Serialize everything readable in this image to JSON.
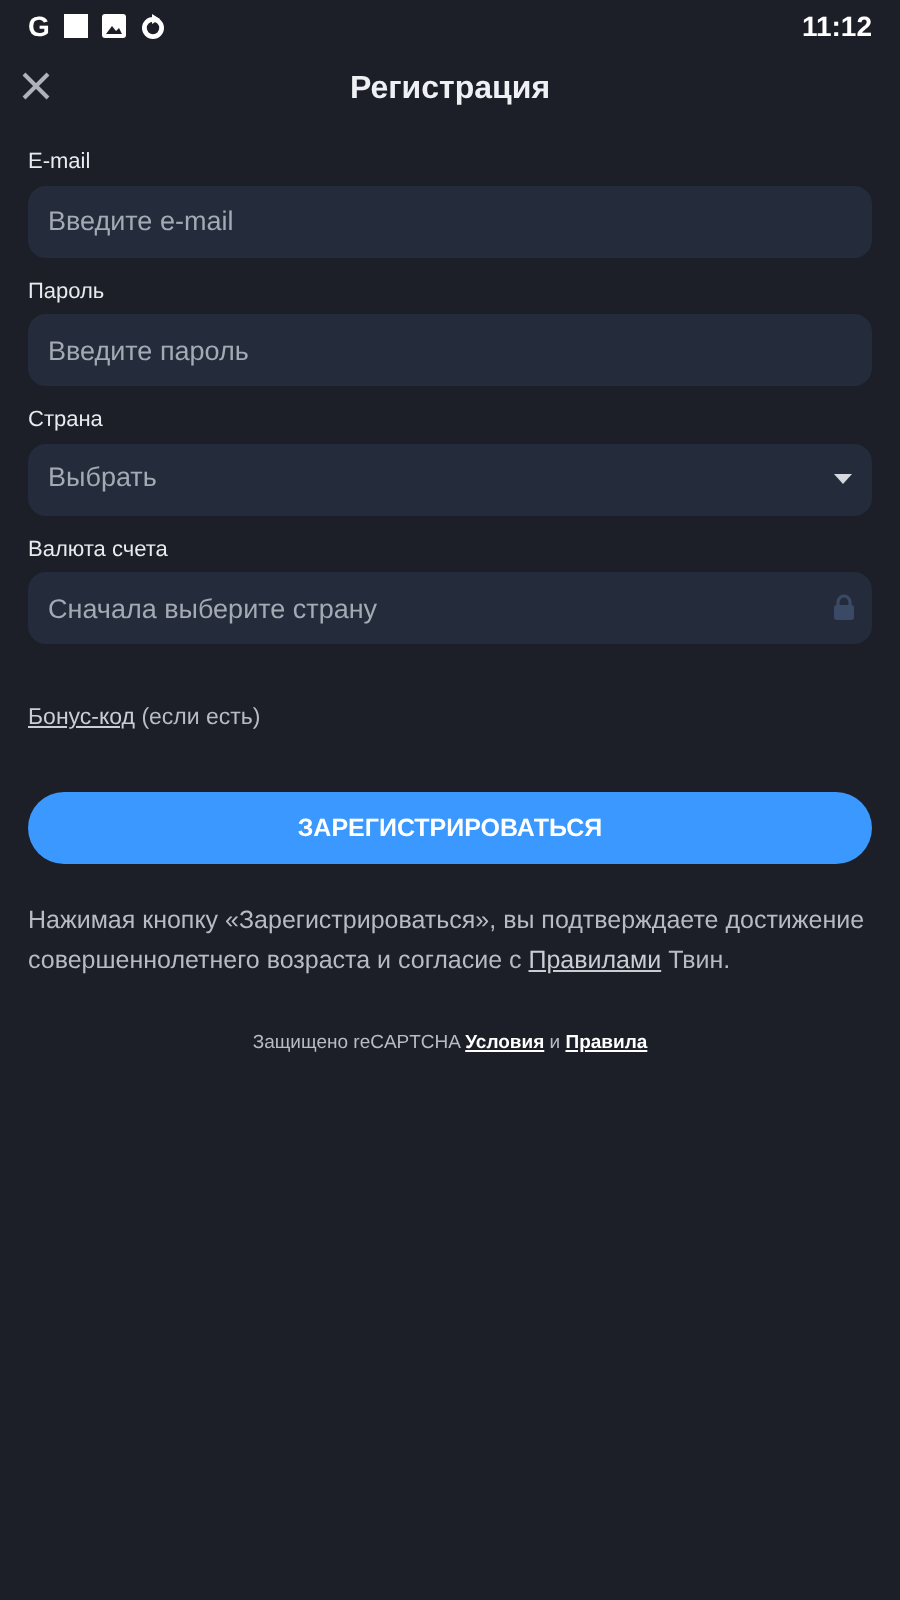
{
  "status_bar": {
    "app_letter": "G",
    "time": "11:12"
  },
  "header": {
    "title": "Регистрация"
  },
  "fields": [
    {
      "kind": "text",
      "label": "E-mail",
      "placeholder": "Введите e-mail"
    },
    {
      "kind": "password",
      "label": "Пароль",
      "placeholder": "Введите пароль"
    },
    {
      "kind": "select",
      "label": "Страна",
      "placeholder": "Выбрать"
    },
    {
      "kind": "locked",
      "label": "Валюта счета",
      "placeholder": "Сначала выберите страну",
      "disabled": true
    }
  ],
  "bonus": {
    "link": "Бонус-код",
    "note": "(если есть)"
  },
  "register_button": "ЗАРЕГИСТРИРОВАТЬСЯ",
  "consent": {
    "before": "Нажимая кнопку «Зарегистрироваться», вы подтверждаете достижение совершеннолетнего возраста и согласие с",
    "link": "Правилами",
    "after": "Твин."
  },
  "captcha": {
    "text": "Защищено reCAPTCHA",
    "terms_link": "Условия",
    "joiner": "и",
    "rules_link": "Правила"
  }
}
